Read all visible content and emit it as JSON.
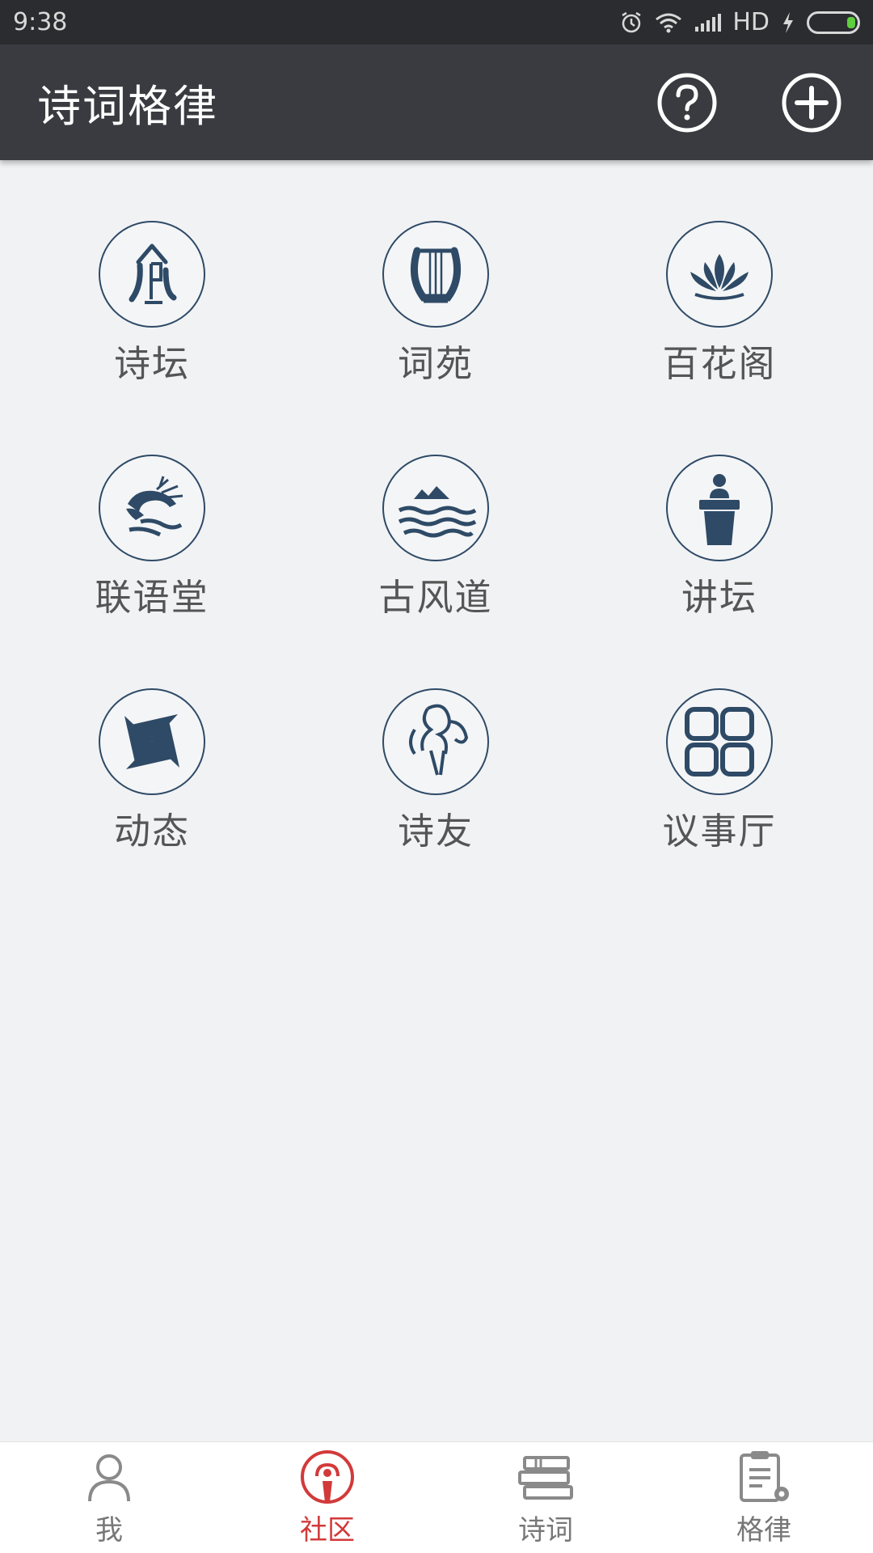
{
  "status_bar": {
    "time": "9:38",
    "network_label": "HD",
    "icons": [
      "alarm-icon",
      "wifi-icon",
      "signal-icon",
      "charging-icon",
      "battery-icon"
    ]
  },
  "app_bar": {
    "title": "诗词格律",
    "actions": [
      {
        "name": "help-icon"
      },
      {
        "name": "add-icon"
      }
    ]
  },
  "grid": {
    "items": [
      {
        "label": "诗坛",
        "icon": "poem-altar-icon"
      },
      {
        "label": "词苑",
        "icon": "lyre-icon"
      },
      {
        "label": "百花阁",
        "icon": "lotus-icon"
      },
      {
        "label": "联语堂",
        "icon": "dragon-icon"
      },
      {
        "label": "古风道",
        "icon": "mountain-waves-icon"
      },
      {
        "label": "讲坛",
        "icon": "podium-icon"
      },
      {
        "label": "动态",
        "icon": "pinwheel-icon"
      },
      {
        "label": "诗友",
        "icon": "friends-icon"
      },
      {
        "label": "议事厅",
        "icon": "grid-squares-icon"
      }
    ]
  },
  "bottom_nav": {
    "items": [
      {
        "label": "我",
        "icon": "user-icon",
        "active": false
      },
      {
        "label": "社区",
        "icon": "community-icon",
        "active": true
      },
      {
        "label": "诗词",
        "icon": "books-icon",
        "active": false
      },
      {
        "label": "格律",
        "icon": "clipboard-settings-icon",
        "active": false
      }
    ]
  },
  "colors": {
    "accent": "#d23a3a",
    "icon_primary": "#2e4a66",
    "app_bar": "#3a3b40",
    "status_bar": "#2b2c30",
    "background": "#f1f2f4"
  }
}
